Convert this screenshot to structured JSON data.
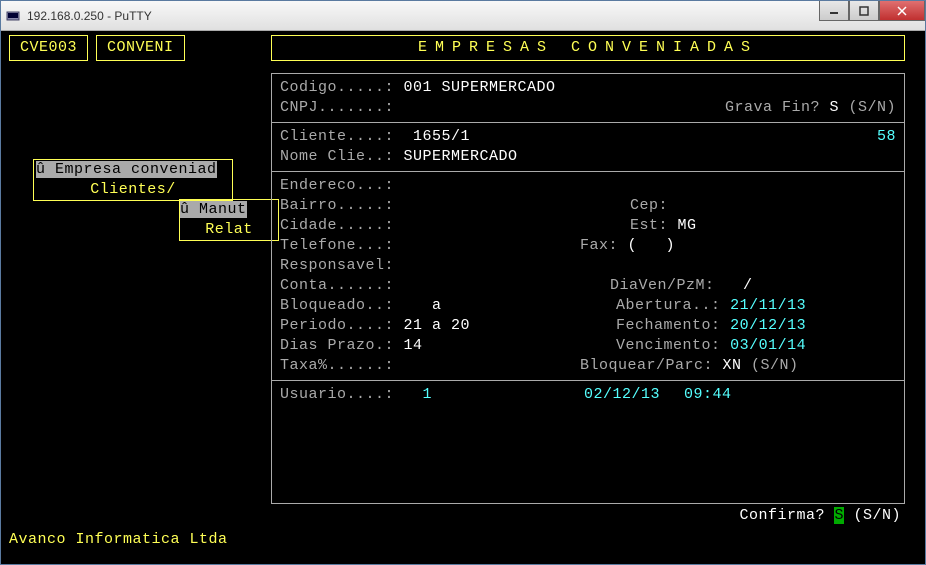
{
  "window": {
    "title": "192.168.0.250 - PuTTY"
  },
  "topbox": {
    "code": "CVE003",
    "module": "CONVENI"
  },
  "banner": "EMPRESAS CONVENIADAS",
  "sidemenu": {
    "item1_mark": "û",
    "item1": " Empresa conveniad",
    "item2": "Clientes/"
  },
  "submenu": {
    "item1_mark": "û",
    "item1": " Manut",
    "item2": "Relat"
  },
  "main": {
    "codigo_lbl": "Codigo.....:",
    "codigo_val": " 001 SUPERMERCADO",
    "cnpj_lbl": "CNPJ.......:",
    "cnpj_val": "",
    "gravafin_lbl": "Grava Fin? ",
    "gravafin_val": "S",
    "gravafin_hint": " (S/N)",
    "cliente_lbl": "Cliente....:",
    "cliente_val": "  1655/1",
    "cliente_right": "58",
    "nomeclie_lbl": "Nome Clie..:",
    "nomeclie_val": " SUPERMERCADO",
    "endereco_lbl": "Endereco...:",
    "bairro_lbl": "Bairro.....:",
    "cep_lbl": "Cep:",
    "cidade_lbl": "Cidade.....:",
    "est_lbl": "Est:",
    "est_val": " MG",
    "telefone_lbl": "Telefone...:",
    "fax_lbl": "Fax:",
    "fax_val": " (   )",
    "responsavel_lbl": "Responsavel:",
    "conta_lbl": "Conta......:",
    "diaven_lbl": "DiaVen/PzM:",
    "diaven_val": "   /",
    "bloqueado_lbl": "Bloqueado..:",
    "bloqueado_val": "    a",
    "abertura_lbl": "Abertura..:",
    "abertura_val": " 21/11/13",
    "periodo_lbl": "Periodo....:",
    "periodo_val": " 21 a 20",
    "fechamento_lbl": "Fechamento:",
    "fechamento_val": " 20/12/13",
    "diasprazo_lbl": "Dias Prazo.:",
    "diasprazo_val": " 14",
    "vencimento_lbl": "Vencimento:",
    "vencimento_val": " 03/01/14",
    "taxa_lbl": "Taxa%......:",
    "bloquear_lbl": "Bloquear/Parc:",
    "bloquear_val": " XN",
    "bloquear_hint": " (S/N)",
    "usuario_lbl": "Usuario....:",
    "usuario_val": "   1",
    "usuario_date": "02/12/13",
    "usuario_time": "09:44"
  },
  "confirm": {
    "label": "Confirma? ",
    "value": "S",
    "hint": " (S/N)"
  },
  "footer": "Avanco Informatica Ltda"
}
